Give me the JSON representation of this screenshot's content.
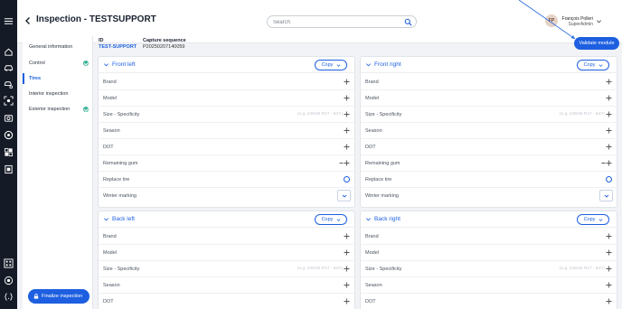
{
  "header": {
    "title": "Inspection - TESTSUPPORT",
    "search_placeholder": "Search",
    "user": {
      "initials": "FP",
      "name": "François Polleri",
      "role": "SuperAdmin"
    }
  },
  "sections": [
    {
      "label": "General information",
      "done": false,
      "active": false
    },
    {
      "label": "Control",
      "done": true,
      "active": false
    },
    {
      "label": "Tires",
      "done": false,
      "active": true
    },
    {
      "label": "Interior inspection",
      "done": false,
      "active": false
    },
    {
      "label": "Exterior inspection",
      "done": true,
      "active": false
    }
  ],
  "finalize_label": "Finalize inspection",
  "info": {
    "id_label": "ID",
    "id_value": "TEST-SUPPORT",
    "capture_label": "Capture sequence",
    "capture_value": "P20250207140059"
  },
  "validate_label": "Validate module",
  "copy_label": "Copy",
  "size_placeholder": "(e.g. 245/45 R17 - 84Y)",
  "fields": {
    "brand": "Brand",
    "model": "Model",
    "size": "Size - Specificity",
    "season": "Season",
    "dot": "DOT",
    "remaining_gum": "Remaining gum",
    "replace_tire": "Replace tire",
    "winter_marking": "Winter marking"
  },
  "tires": {
    "front_left": "Front left",
    "front_right": "Front right",
    "back_left": "Back left",
    "back_right": "Back right"
  },
  "colors": {
    "accent": "#1d5fe0",
    "rail": "#141a26",
    "done": "#3fb39a"
  },
  "icons": [
    "menu-icon",
    "home-icon",
    "car-icon",
    "car-search-icon",
    "scan-icon",
    "camera-icon",
    "wheel-icon",
    "grid-icon",
    "report-icon",
    "qr-code-icon",
    "eye-icon",
    "code-icon"
  ]
}
